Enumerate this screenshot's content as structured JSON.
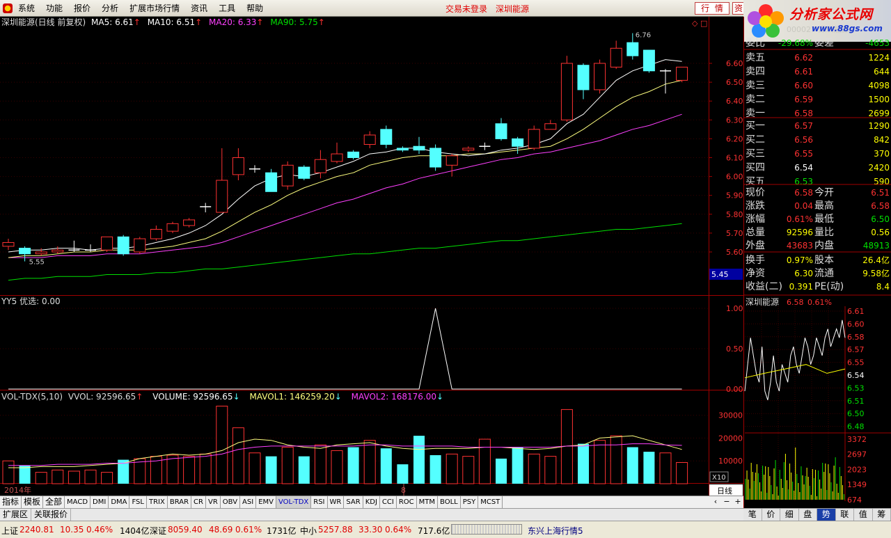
{
  "menu": [
    "系统",
    "功能",
    "报价",
    "分析",
    "扩展市场行情",
    "资讯",
    "工具",
    "帮助"
  ],
  "status_login": "交易未登录",
  "status_stock": "深圳能源",
  "top_buttons": [
    "行",
    "情",
    "资"
  ],
  "logo": {
    "title": "分析家公式网",
    "url": "www.88gs.com",
    "ghost": "000027 深圳能源"
  },
  "price_panel": {
    "header": {
      "name": "深圳能源(日线 前复权)",
      "ma5": "MA5: 6.61",
      "ma10": "MA10: 6.51",
      "ma20": "MA20: 6.33",
      "ma90": "MA90: 5.75"
    },
    "y_ticks": [
      "6.60",
      "6.50",
      "6.40",
      "6.30",
      "6.20",
      "6.10",
      "6.00",
      "5.90",
      "5.80",
      "5.70",
      "5.60"
    ],
    "cursor_price": "5.45",
    "high_label": "6.76",
    "low_label": "5.55",
    "candles": [
      {
        "o": 5.63,
        "c": 5.65,
        "h": 5.67,
        "l": 5.61
      },
      {
        "o": 5.62,
        "c": 5.59,
        "h": 5.63,
        "l": 5.55
      },
      {
        "o": 5.59,
        "c": 5.6,
        "h": 5.62,
        "l": 5.58
      },
      {
        "o": 5.6,
        "c": 5.61,
        "h": 5.63,
        "l": 5.59
      },
      {
        "o": 5.61,
        "c": 5.61,
        "h": 5.66,
        "l": 5.6
      },
      {
        "o": 5.61,
        "c": 5.61,
        "h": 5.64,
        "l": 5.6
      },
      {
        "o": 5.61,
        "c": 5.68,
        "h": 5.68,
        "l": 5.6
      },
      {
        "o": 5.68,
        "c": 5.59,
        "h": 5.69,
        "l": 5.58
      },
      {
        "o": 5.6,
        "c": 5.67,
        "h": 5.68,
        "l": 5.59
      },
      {
        "o": 5.67,
        "c": 5.72,
        "h": 5.74,
        "l": 5.66
      },
      {
        "o": 5.71,
        "c": 5.75,
        "h": 5.76,
        "l": 5.7
      },
      {
        "o": 5.74,
        "c": 5.77,
        "h": 5.78,
        "l": 5.73
      },
      {
        "o": 5.84,
        "c": 5.84,
        "h": 5.86,
        "l": 5.81
      },
      {
        "o": 5.81,
        "c": 5.98,
        "h": 6.15,
        "l": 5.81
      },
      {
        "o": 6.01,
        "c": 6.1,
        "h": 6.15,
        "l": 5.98
      },
      {
        "o": 6.04,
        "c": 6.04,
        "h": 6.06,
        "l": 6.02
      },
      {
        "o": 6.02,
        "c": 5.92,
        "h": 6.04,
        "l": 5.92
      },
      {
        "o": 5.95,
        "c": 6.06,
        "h": 6.08,
        "l": 5.93
      },
      {
        "o": 6.05,
        "c": 5.99,
        "h": 6.06,
        "l": 5.98
      },
      {
        "o": 6.02,
        "c": 6.09,
        "h": 6.14,
        "l": 5.99
      },
      {
        "o": 6.08,
        "c": 6.12,
        "h": 6.18,
        "l": 6.07
      },
      {
        "o": 6.13,
        "c": 6.1,
        "h": 6.14,
        "l": 6.09
      },
      {
        "o": 6.17,
        "c": 6.22,
        "h": 6.24,
        "l": 6.15
      },
      {
        "o": 6.25,
        "c": 6.17,
        "h": 6.27,
        "l": 6.15
      },
      {
        "o": 6.15,
        "c": 6.14,
        "h": 6.16,
        "l": 6.13
      },
      {
        "o": 6.16,
        "c": 6.14,
        "h": 6.21,
        "l": 6.12
      },
      {
        "o": 6.15,
        "c": 6.05,
        "h": 6.17,
        "l": 6.03
      },
      {
        "o": 6.06,
        "c": 6.11,
        "h": 6.12,
        "l": 6.0
      },
      {
        "o": 6.14,
        "c": 6.15,
        "h": 6.16,
        "l": 6.13
      },
      {
        "o": 6.16,
        "c": 6.16,
        "h": 6.18,
        "l": 6.14
      },
      {
        "o": 6.28,
        "c": 6.2,
        "h": 6.31,
        "l": 6.19
      },
      {
        "o": 6.2,
        "c": 6.16,
        "h": 6.21,
        "l": 6.12
      },
      {
        "o": 6.15,
        "c": 6.25,
        "h": 6.27,
        "l": 6.14
      },
      {
        "o": 6.25,
        "c": 6.28,
        "h": 6.3,
        "l": 6.25
      },
      {
        "o": 6.3,
        "c": 6.6,
        "h": 6.64,
        "l": 6.29
      },
      {
        "o": 6.59,
        "c": 6.46,
        "h": 6.6,
        "l": 6.41
      },
      {
        "o": 6.46,
        "c": 6.6,
        "h": 6.62,
        "l": 6.44
      },
      {
        "o": 6.58,
        "c": 6.68,
        "h": 6.72,
        "l": 6.57
      },
      {
        "o": 6.71,
        "c": 6.64,
        "h": 6.76,
        "l": 6.62
      },
      {
        "o": 6.67,
        "c": 6.56,
        "h": 6.67,
        "l": 6.55
      },
      {
        "o": 6.56,
        "c": 6.56,
        "h": 6.57,
        "l": 6.44
      },
      {
        "o": 6.51,
        "c": 6.58,
        "h": 6.58,
        "l": 6.5
      }
    ],
    "ma5": [
      5.6,
      5.61,
      5.61,
      5.62,
      5.62,
      5.61,
      5.62,
      5.62,
      5.63,
      5.65,
      5.67,
      5.7,
      5.74,
      5.8,
      5.88,
      5.95,
      5.99,
      6.01,
      6.0,
      6.02,
      6.05,
      6.08,
      6.12,
      6.13,
      6.15,
      6.15,
      6.13,
      6.12,
      6.11,
      6.12,
      6.14,
      6.15,
      6.17,
      6.2,
      6.28,
      6.33,
      6.42,
      6.51,
      6.56,
      6.59,
      6.62,
      6.61
    ],
    "ma10": [
      5.57,
      5.58,
      5.58,
      5.59,
      5.6,
      5.6,
      5.61,
      5.61,
      5.61,
      5.62,
      5.63,
      5.65,
      5.67,
      5.71,
      5.76,
      5.81,
      5.85,
      5.9,
      5.94,
      5.97,
      6.0,
      6.02,
      6.06,
      6.08,
      6.1,
      6.11,
      6.11,
      6.11,
      6.12,
      6.12,
      6.13,
      6.14,
      6.15,
      6.16,
      6.2,
      6.25,
      6.31,
      6.37,
      6.42,
      6.45,
      6.49,
      6.51
    ],
    "ma20": [
      5.57,
      5.57,
      5.57,
      5.58,
      5.58,
      5.58,
      5.59,
      5.59,
      5.59,
      5.6,
      5.61,
      5.62,
      5.63,
      5.65,
      5.68,
      5.71,
      5.74,
      5.77,
      5.8,
      5.83,
      5.86,
      5.88,
      5.91,
      5.94,
      5.96,
      5.99,
      6.01,
      6.03,
      6.05,
      6.07,
      6.09,
      6.1,
      6.12,
      6.13,
      6.15,
      6.17,
      6.19,
      6.22,
      6.25,
      6.27,
      6.3,
      6.33
    ],
    "ma90": [
      5.45,
      5.46,
      5.46,
      5.47,
      5.47,
      5.47,
      5.48,
      5.48,
      5.48,
      5.49,
      5.49,
      5.5,
      5.51,
      5.51,
      5.52,
      5.53,
      5.54,
      5.55,
      5.56,
      5.57,
      5.58,
      5.59,
      5.59,
      5.6,
      5.61,
      5.62,
      5.62,
      5.63,
      5.64,
      5.65,
      5.66,
      5.66,
      5.67,
      5.68,
      5.69,
      5.7,
      5.71,
      5.72,
      5.72,
      5.73,
      5.74,
      5.75
    ]
  },
  "yy5_panel": {
    "header": "YY5 优选: 0.00",
    "y_ticks": [
      "1.00",
      "0.50",
      "0.00"
    ],
    "values": [
      0,
      0,
      0,
      0,
      0,
      0,
      0,
      0,
      0,
      0,
      0,
      0,
      0,
      0,
      0,
      0,
      0,
      0,
      0,
      0,
      0,
      0,
      0,
      0,
      0,
      0,
      1,
      0,
      0,
      0,
      0,
      0,
      0,
      0,
      0,
      0,
      0,
      0,
      0,
      0,
      0,
      0
    ]
  },
  "vol_panel": {
    "header": {
      "name": "VOL-TDX(5,10)",
      "vvol": "VVOL: 92596.65",
      "volume": "VOLUME: 92596.65",
      "mavol1": "MAVOL1: 146259.20",
      "mavol2": "MAVOL2: 168176.00"
    },
    "y_ticks": [
      "30000",
      "20000",
      "10000"
    ],
    "unit": "X10",
    "volumes": [
      10000,
      8000,
      5000,
      6000,
      5500,
      6000,
      5000,
      10500,
      11000,
      12000,
      12500,
      12000,
      13000,
      34000,
      24500,
      13500,
      12000,
      16000,
      12000,
      17000,
      14500,
      16000,
      19000,
      15500,
      8500,
      21000,
      12500,
      13000,
      12000,
      19500,
      11000,
      16000,
      13000,
      12000,
      32500,
      17500,
      19000,
      21000,
      16000,
      14000,
      13500,
      9300
    ],
    "mavol1": [
      7000,
      7000,
      7500,
      7500,
      7500,
      8000,
      8500,
      9000,
      11000,
      12000,
      13000,
      12500,
      13000,
      14500,
      18000,
      19500,
      19000,
      17000,
      16000,
      15500,
      17000,
      17500,
      18000,
      16500,
      15500,
      15000,
      15500,
      15500,
      15500,
      16000,
      16000,
      15500,
      15000,
      15500,
      16500,
      17000,
      20000,
      20500,
      21000,
      19000,
      17000,
      15000
    ],
    "mavol2": [
      8000,
      8000,
      8000,
      8500,
      8500,
      8500,
      9000,
      9000,
      9500,
      10000,
      11000,
      11500,
      12000,
      13000,
      15000,
      16000,
      16500,
      16500,
      16500,
      16500,
      16500,
      16500,
      17000,
      17000,
      16500,
      16500,
      16500,
      16500,
      16000,
      16000,
      16000,
      16000,
      16000,
      16000,
      16500,
      16500,
      17000,
      17000,
      17500,
      17500,
      17000,
      16800
    ]
  },
  "x_axis": {
    "year": "2014年",
    "month": "8"
  },
  "indicator_tabs": [
    "指标",
    "模板",
    "全部",
    "MACD",
    "DMI",
    "DMA",
    "FSL",
    "TRIX",
    "BRAR",
    "CR",
    "VR",
    "OBV",
    "ASI",
    "EMV",
    "VOL-TDX",
    "RSI",
    "WR",
    "SAR",
    "KDJ",
    "CCI",
    "ROC",
    "MTM",
    "BOLL",
    "PSY",
    "MCST"
  ],
  "active_indicator": "VOL-TDX",
  "bottom_tabs": [
    "扩展区",
    "关联报价"
  ],
  "period": "日线",
  "quote": {
    "weibi": {
      "label": "委比",
      "value": "-29.68%"
    },
    "weicha": {
      "label": "委差",
      "value": "-4653"
    },
    "asks": [
      {
        "label": "卖五",
        "price": "6.62",
        "vol": "1224"
      },
      {
        "label": "卖四",
        "price": "6.61",
        "vol": "644"
      },
      {
        "label": "卖三",
        "price": "6.60",
        "vol": "4098"
      },
      {
        "label": "卖二",
        "price": "6.59",
        "vol": "1500"
      },
      {
        "label": "卖一",
        "price": "6.58",
        "vol": "2699"
      }
    ],
    "bids": [
      {
        "label": "买一",
        "price": "6.57",
        "vol": "1290"
      },
      {
        "label": "买二",
        "price": "6.56",
        "vol": "842"
      },
      {
        "label": "买三",
        "price": "6.55",
        "vol": "370"
      },
      {
        "label": "买四",
        "price": "6.54",
        "vol": "2420"
      },
      {
        "label": "买五",
        "price": "6.53",
        "vol": "590"
      }
    ],
    "stats": [
      {
        "l1": "现价",
        "v1": "6.58",
        "l2": "今开",
        "v2": "6.51"
      },
      {
        "l1": "涨跌",
        "v1": "0.04",
        "l2": "最高",
        "v2": "6.58"
      },
      {
        "l1": "涨幅",
        "v1": "0.61%",
        "l2": "最低",
        "v2": "6.50"
      },
      {
        "l1": "总量",
        "v1": "92596",
        "l2": "量比",
        "v2": "0.56"
      },
      {
        "l1": "外盘",
        "v1": "43683",
        "l2": "内盘",
        "v2": "48913"
      }
    ],
    "stats2": [
      {
        "l1": "换手",
        "v1": "0.97%",
        "l2": "股本",
        "v2": "26.4亿"
      },
      {
        "l1": "净资",
        "v1": "6.30",
        "l2": "流通",
        "v2": "9.58亿"
      },
      {
        "l1": "收益(二)",
        "v1": "0.391",
        "l2": "PE(动)",
        "v2": "8.4"
      }
    ]
  },
  "mini_chart": {
    "title": "深圳能源",
    "price": "6.58",
    "pct": "0.61%",
    "price_ticks": [
      "6.61",
      "6.60",
      "6.58",
      "6.57",
      "6.55",
      "6.54",
      "6.53",
      "6.51",
      "6.50",
      "6.48"
    ],
    "vol_ticks": [
      "3372",
      "2697",
      "2023",
      "1349",
      "674"
    ]
  },
  "right_tabs": [
    "笔",
    "价",
    "细",
    "盘",
    "势",
    "联",
    "值",
    "筹"
  ],
  "active_right_tab": "势",
  "status": {
    "sh_label": "上证",
    "sh_idx": "2240.81",
    "sh_chg": "10.35",
    "sh_pct": "0.46%",
    "sh_amt": "1404亿",
    "sz_label": "深证",
    "sz_idx": "8059.40",
    "sz_chg": "48.69",
    "sz_pct": "0.61%",
    "sz_amt": "1731亿",
    "zx_label": "中小",
    "zx_idx": "5257.88",
    "zx_chg": "33.30",
    "zx_pct": "0.64%",
    "zx_amt": "717.6亿",
    "server": "东兴上海行情5"
  },
  "colors": {
    "up": "#ff3232",
    "down": "#54ffff",
    "ma5": "#ffffff",
    "ma10": "#ffff80",
    "ma20": "#ff40ff",
    "ma90": "#00e000"
  }
}
